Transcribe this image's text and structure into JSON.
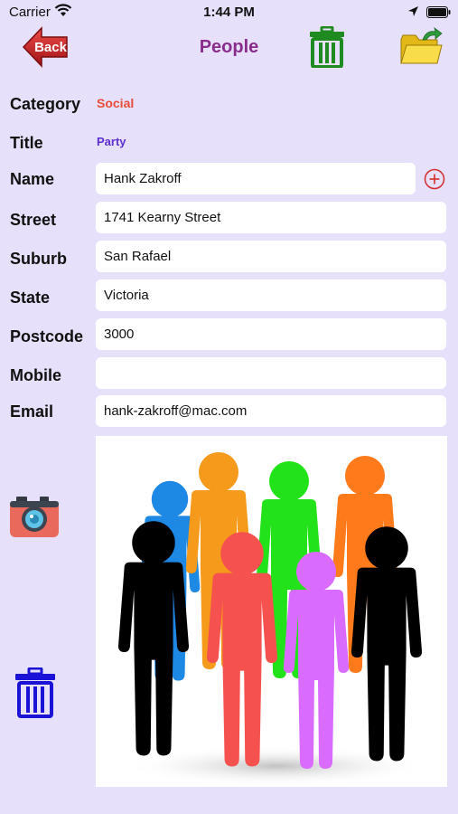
{
  "status": {
    "carrier": "Carrier",
    "time": "1:44 PM"
  },
  "nav": {
    "title": "People",
    "back_label": "Back",
    "icons": [
      "back-arrow-icon",
      "trash-icon",
      "folder-icon"
    ]
  },
  "form": {
    "category": {
      "label": "Category",
      "value": "Social",
      "color": "#e94b3c"
    },
    "title": {
      "label": "Title",
      "value": "Party",
      "color": "#5a2ed0"
    },
    "name": {
      "label": "Name",
      "value": "Hank Zakroff"
    },
    "street": {
      "label": "Street",
      "value": "1741 Kearny Street"
    },
    "suburb": {
      "label": "Suburb",
      "value": "San Rafael"
    },
    "state": {
      "label": "State",
      "value": "Victoria"
    },
    "postcode": {
      "label": "Postcode",
      "value": "3000"
    },
    "mobile": {
      "label": "Mobile",
      "value": ""
    },
    "email": {
      "label": "Email",
      "value": "hank-zakroff@mac.com"
    }
  },
  "photo": {
    "subject": "group-of-people-figures",
    "colors": [
      "#1e88e5",
      "#f59a1a",
      "#22e21a",
      "#ff7a1a",
      "#000000",
      "#f5524f",
      "#d96bff",
      "#000000"
    ]
  },
  "accent": {
    "trash_green": "#1f8a1f",
    "trash_blue": "#1a12d6",
    "add_red": "#d42b2b",
    "back_red": "#c42020"
  }
}
